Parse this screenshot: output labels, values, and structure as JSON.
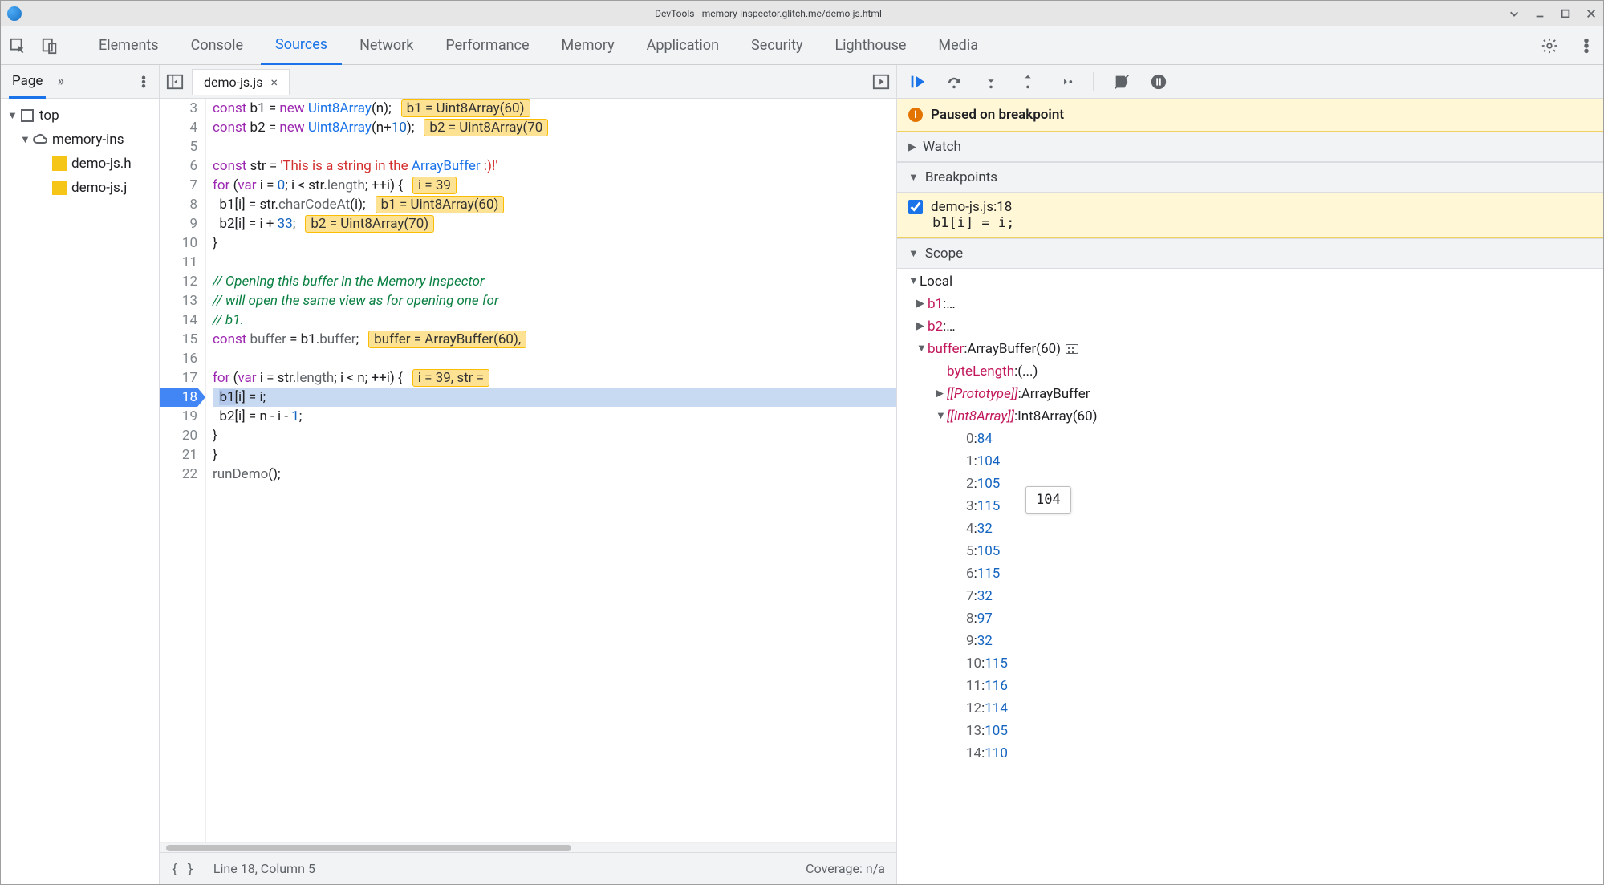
{
  "window": {
    "title": "DevTools - memory-inspector.glitch.me/demo-js.html"
  },
  "mainTabs": [
    "Elements",
    "Console",
    "Sources",
    "Network",
    "Performance",
    "Memory",
    "Application",
    "Security",
    "Lighthouse",
    "Media"
  ],
  "mainTabActive": "Sources",
  "navigator": {
    "activeTab": "Page",
    "tree": {
      "top": "top",
      "domain": "memory-ins",
      "files": [
        "demo-js.h",
        "demo-js.j"
      ]
    }
  },
  "editor": {
    "tabName": "demo-js.js",
    "statusPos": "Line 18, Column 5",
    "statusCoverage": "Coverage: n/a",
    "execLine": 18,
    "lines": [
      {
        "n": 3,
        "code": "const b1 = new Uint8Array(n);",
        "hint": "b1 = Uint8Array(60)"
      },
      {
        "n": 4,
        "code": "const b2 = new Uint8Array(n+10);",
        "hint": "b2 = Uint8Array(70"
      },
      {
        "n": 5,
        "code": ""
      },
      {
        "n": 6,
        "code": "const str = 'This is a string in the ArrayBuffer :)!'"
      },
      {
        "n": 7,
        "code": "for (var i = 0; i < str.length; ++i) {",
        "hint": "i = 39"
      },
      {
        "n": 8,
        "code": "  b1[i] = str.charCodeAt(i);",
        "hint": "b1 = Uint8Array(60)"
      },
      {
        "n": 9,
        "code": "  b2[i] = i + 33;",
        "hint": "b2 = Uint8Array(70)"
      },
      {
        "n": 10,
        "code": "}"
      },
      {
        "n": 11,
        "code": ""
      },
      {
        "n": 12,
        "code": "// Opening this buffer in the Memory Inspector"
      },
      {
        "n": 13,
        "code": "// will open the same view as for opening one for"
      },
      {
        "n": 14,
        "code": "// b1."
      },
      {
        "n": 15,
        "code": "const buffer = b1.buffer;",
        "hint": "buffer = ArrayBuffer(60),"
      },
      {
        "n": 16,
        "code": ""
      },
      {
        "n": 17,
        "code": "for (var i = str.length; i < n; ++i) {",
        "hint": "i = 39, str ="
      },
      {
        "n": 18,
        "code": "  b1[i] = i;"
      },
      {
        "n": 19,
        "code": "  b2[i] = n - i - 1;"
      },
      {
        "n": 20,
        "code": "}"
      },
      {
        "n": 21,
        "code": "}"
      },
      {
        "n": 22,
        "code": "runDemo();"
      }
    ]
  },
  "debugger": {
    "pausedBanner": "Paused on breakpoint",
    "sections": {
      "watch": "Watch",
      "breakpoints": "Breakpoints",
      "scope": "Scope"
    },
    "breakpoints": [
      {
        "location": "demo-js.js:18",
        "src": "b1[i] = i;",
        "enabled": true
      }
    ],
    "scope": {
      "localLabel": "Local",
      "b1": {
        "name": "b1",
        "display": "…"
      },
      "b2": {
        "name": "b2",
        "display": "…"
      },
      "buffer": {
        "name": "buffer",
        "type": "ArrayBuffer(60)",
        "byteLengthLabel": "byteLength",
        "byteLengthVal": "(...)",
        "proto": {
          "label": "[[Prototype]]",
          "val": "ArrayBuffer"
        },
        "int8": {
          "label": "[[Int8Array]]",
          "type": "Int8Array(60)",
          "items": [
            {
              "i": 0,
              "v": 84
            },
            {
              "i": 1,
              "v": 104
            },
            {
              "i": 2,
              "v": 105
            },
            {
              "i": 3,
              "v": 115
            },
            {
              "i": 4,
              "v": 32
            },
            {
              "i": 5,
              "v": 105
            },
            {
              "i": 6,
              "v": 115
            },
            {
              "i": 7,
              "v": 32
            },
            {
              "i": 8,
              "v": 97
            },
            {
              "i": 9,
              "v": 32
            },
            {
              "i": 10,
              "v": 115
            },
            {
              "i": 11,
              "v": 116
            },
            {
              "i": 12,
              "v": 114
            },
            {
              "i": 13,
              "v": 105
            },
            {
              "i": 14,
              "v": 110
            }
          ]
        }
      }
    },
    "hoverTooltip": "104"
  }
}
